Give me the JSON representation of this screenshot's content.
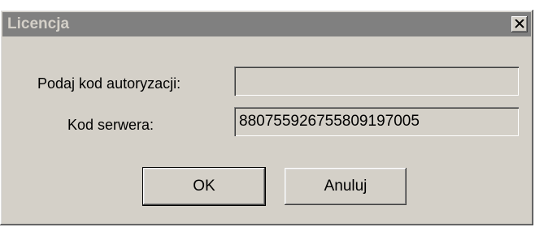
{
  "window": {
    "title": "Licencja"
  },
  "form": {
    "auth_code_label": "Podaj kod autoryzacji:",
    "auth_code_value": "",
    "server_code_label": "Kod serwera:",
    "server_code_value": "880755926755809197005"
  },
  "buttons": {
    "ok_label": "OK",
    "cancel_label": "Anuluj"
  },
  "colors": {
    "face": "#d4d0c8",
    "inactive_titlebar": "#808080",
    "inactive_title_text": "#d4d0c8"
  },
  "icons": {
    "close": "close-icon"
  }
}
